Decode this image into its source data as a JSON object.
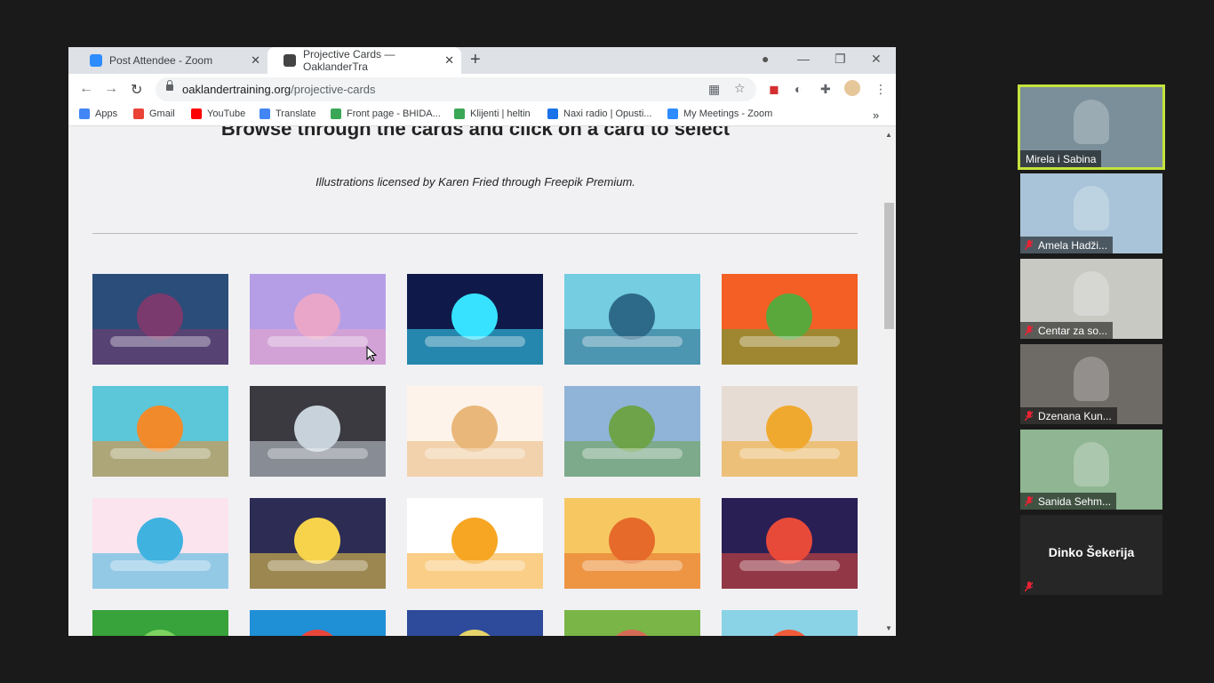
{
  "browser": {
    "tabs": [
      {
        "title": "Post Attendee - Zoom",
        "color": "#2d8cff"
      },
      {
        "title": "Projective Cards — OaklanderTra",
        "color": "#444444"
      }
    ],
    "url_host": "oaklandertraining.org",
    "url_path": "/projective-cards",
    "bookmarks": [
      {
        "label": "Apps",
        "color": "#4285f4"
      },
      {
        "label": "Gmail",
        "color": "#ea4335"
      },
      {
        "label": "YouTube",
        "color": "#ff0000"
      },
      {
        "label": "Translate",
        "color": "#4285f4"
      },
      {
        "label": "Front page - BHIDA...",
        "color": "#3aa757"
      },
      {
        "label": "Klijenti | heltin",
        "color": "#3aa757"
      },
      {
        "label": "Naxi radio | Opusti...",
        "color": "#1a73e8"
      },
      {
        "label": "My Meetings - Zoom",
        "color": "#2d8cff"
      }
    ]
  },
  "page": {
    "heading": "Browse through the cards and click on a card to select",
    "credit": "Illustrations licensed by Karen Fried through Freepik Premium."
  },
  "cards": [
    {
      "name": "card-van-mountains",
      "bg": "#2b4d7a",
      "accent": "#7a3a6e"
    },
    {
      "name": "card-rainbow-castle",
      "bg": "#b59ee6",
      "accent": "#e9a6c8"
    },
    {
      "name": "card-fountain",
      "bg": "#101a4a",
      "accent": "#36e2ff"
    },
    {
      "name": "card-dolphin",
      "bg": "#74cde0",
      "accent": "#2d6a8a"
    },
    {
      "name": "card-dragon",
      "bg": "#f45f25",
      "accent": "#5aa83c"
    },
    {
      "name": "card-flip-flops-beach",
      "bg": "#5cc7d9",
      "accent": "#f18a2a"
    },
    {
      "name": "card-tornado",
      "bg": "#3a3a40",
      "accent": "#c8d2da"
    },
    {
      "name": "card-teddy-bear",
      "bg": "#fdf3ea",
      "accent": "#e9b77a"
    },
    {
      "name": "card-mountain-landscape",
      "bg": "#8fb4d8",
      "accent": "#6ea34a"
    },
    {
      "name": "card-drum-kit",
      "bg": "#e7dcd3",
      "accent": "#f0a92f"
    },
    {
      "name": "card-butterflies",
      "bg": "#fbe4ee",
      "accent": "#3fb2e0"
    },
    {
      "name": "card-magic-hat",
      "bg": "#2c2c55",
      "accent": "#f7d34b"
    },
    {
      "name": "card-social-phone",
      "bg": "#ffffff",
      "accent": "#f6a623"
    },
    {
      "name": "card-autumn-lake",
      "bg": "#f7c861",
      "accent": "#e66b2b"
    },
    {
      "name": "card-rocket",
      "bg": "#2a1f55",
      "accent": "#e84a3a"
    },
    {
      "name": "card-green-leaf",
      "bg": "#37a33a",
      "accent": "#7dd35f"
    },
    {
      "name": "card-coral",
      "bg": "#1f8fd6",
      "accent": "#e8463b"
    },
    {
      "name": "card-night-sea",
      "bg": "#2e4a9a",
      "accent": "#e6d36a"
    },
    {
      "name": "card-grass",
      "bg": "#7ab547",
      "accent": "#d56b55"
    },
    {
      "name": "card-kite-sky",
      "bg": "#8ad2e6",
      "accent": "#f15b3a"
    }
  ],
  "participants": [
    {
      "name": "Mirela i Sabina",
      "bg": "#7a8f9a",
      "active": true,
      "muted": false
    },
    {
      "name": "Amela Hadži...",
      "bg": "#a9c4d8",
      "active": false,
      "muted": true
    },
    {
      "name": "Centar za so...",
      "bg": "#c9c9c4",
      "active": false,
      "muted": true
    },
    {
      "name": "Dzenana Kun...",
      "bg": "#6e6a66",
      "active": false,
      "muted": true
    },
    {
      "name": "Sanida Sehm...",
      "bg": "#8fb592",
      "active": false,
      "muted": true
    },
    {
      "name": "Dinko Šekerija",
      "bg": "#262626",
      "active": false,
      "muted": true
    }
  ]
}
